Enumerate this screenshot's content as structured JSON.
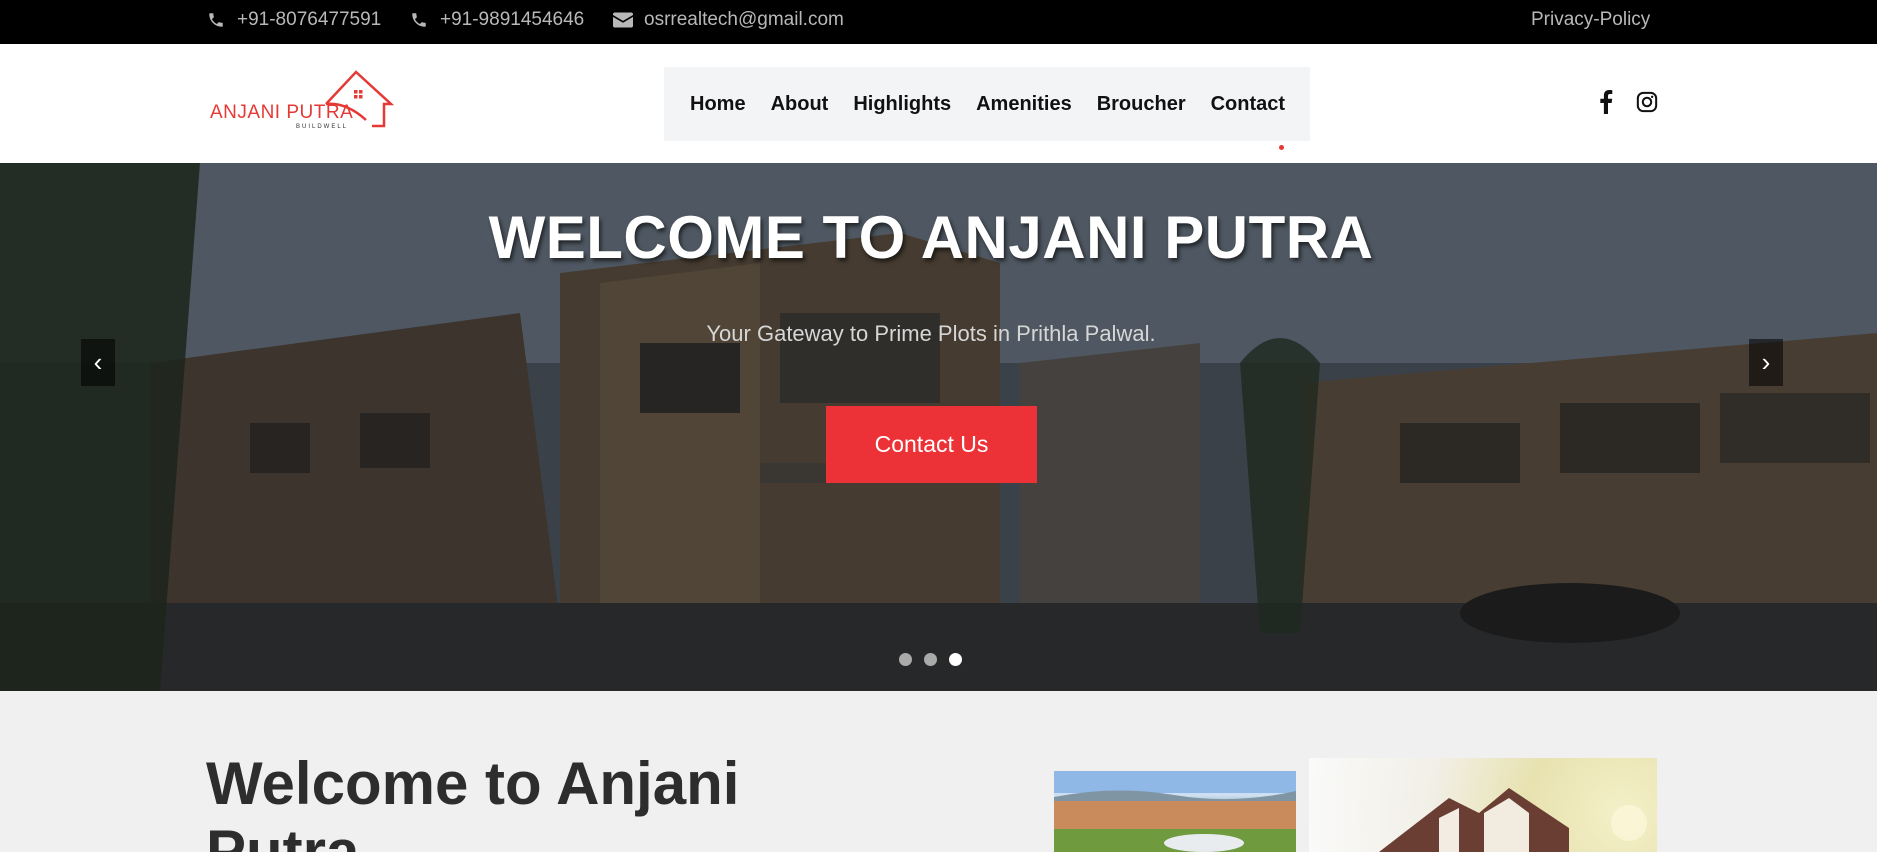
{
  "topbar": {
    "phone1": "+91-8076477591",
    "phone2": "+91-9891454646",
    "email": "osrrealtech@gmail.com",
    "privacy": "Privacy-Policy"
  },
  "logo": {
    "name": "ANJANI PUTRA",
    "tagline": "BUILDWELL"
  },
  "nav": {
    "items": [
      "Home",
      "About",
      "Highlights",
      "Amenities",
      "Broucher",
      "Contact"
    ]
  },
  "social": {
    "icons": [
      "facebook-icon",
      "instagram-icon"
    ]
  },
  "hero": {
    "title": "WELCOME TO ANJANI PUTRA",
    "subtitle": "Your Gateway to Prime Plots in Prithla Palwal.",
    "button": "Contact Us",
    "prev": "‹",
    "next": "›",
    "slides": 3,
    "active_slide": 3
  },
  "welcome": {
    "title": "Welcome to Anjani Putra"
  },
  "colors": {
    "accent": "#ed3237",
    "topbar": "#000000",
    "nav_bg": "#f3f4f6"
  }
}
